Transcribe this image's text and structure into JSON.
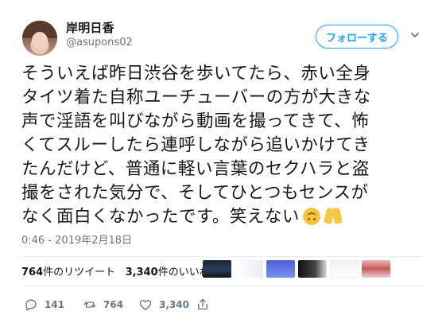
{
  "user": {
    "name": "岸明日香",
    "handle": "@asupons02"
  },
  "header": {
    "follow_label": "フォローする"
  },
  "tweet": {
    "line1": "そういえば昨日渋谷を歩いてたら、赤い全身",
    "line2": "タイツ着た自称ユーチューバーの方が大きな",
    "line3": "声で淫語を叫びながら動画を撮ってきて、怖",
    "line4": "くてスルーしたら連呼しながら追いかけてき",
    "line5": "たんだけど、普通に軽い言葉のセクハラと盗",
    "line6": "撮をされた気分で、そしてひとつもセンスが",
    "line7": "なく面白くなかったです。笑えない",
    "emojis": [
      "upside-down-face-icon",
      "folded-hands-icon"
    ],
    "timestamp": "0:46 - 2019年2月18日"
  },
  "stats": {
    "retweet_count": "764",
    "retweet_label": "件のリツイート",
    "like_count": "3,340",
    "like_label": "件のいいね"
  },
  "actions": {
    "reply_count": "141",
    "retweet_count": "764",
    "like_count": "3,340"
  },
  "colors": {
    "accent": "#1da1f2",
    "muted": "#657786",
    "divider": "#e6ecf0"
  }
}
